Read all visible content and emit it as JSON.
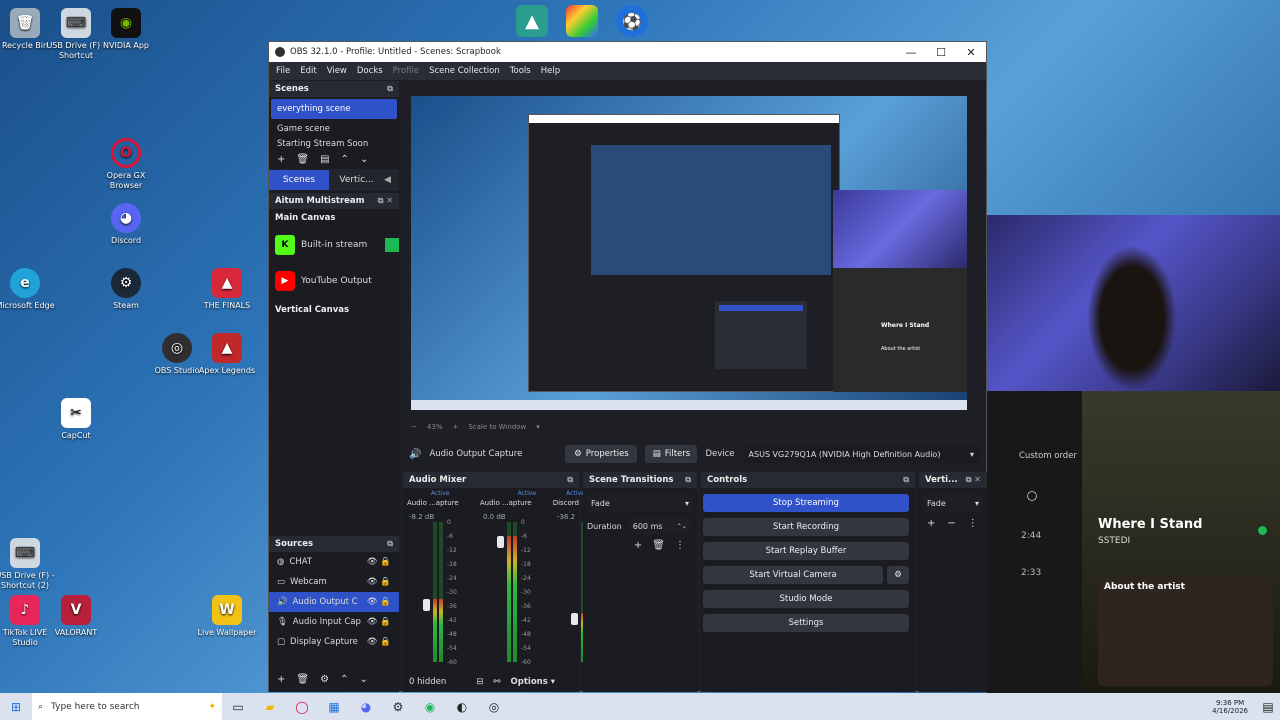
{
  "desktop_icons": [
    {
      "label": "Recycle Bin",
      "icon": "recycle-bin-icon",
      "glyph": "🗑",
      "color": "#9ab"
    },
    {
      "label": "USB Drive (F) - Shortcut",
      "icon": "usb-drive-icon",
      "glyph": "⌨",
      "color": "#cfd8e0"
    },
    {
      "label": "NVIDIA App",
      "icon": "nvidia-icon",
      "glyph": "◉",
      "color": "#76b900"
    },
    {
      "label": "Opera GX Browser",
      "icon": "opera-gx-icon",
      "glyph": "O",
      "color": "#d8143a"
    },
    {
      "label": "Discord",
      "icon": "discord-icon",
      "glyph": "◕",
      "color": "#5865f2"
    },
    {
      "label": "Microsoft Edge",
      "icon": "edge-icon",
      "glyph": "e",
      "color": "#1fa3d9"
    },
    {
      "label": "Steam",
      "icon": "steam-icon",
      "glyph": "⚙",
      "color": "#1b2838"
    },
    {
      "label": "THE FINALS",
      "icon": "the-finals-icon",
      "glyph": "▲",
      "color": "#d8283a"
    },
    {
      "label": "OBS Studio",
      "icon": "obs-icon",
      "glyph": "◎",
      "color": "#302e31"
    },
    {
      "label": "Apex Legends",
      "icon": "apex-icon",
      "glyph": "▲",
      "color": "#c0282a"
    },
    {
      "label": "CapCut",
      "icon": "capcut-icon",
      "glyph": "✂",
      "color": "#ffffff"
    },
    {
      "label": "USB Drive (F) - Shortcut (2)",
      "icon": "usb-drive-icon",
      "glyph": "⌨",
      "color": "#cfd8e0"
    },
    {
      "label": "TikTok LIVE Studio",
      "icon": "tiktok-icon",
      "glyph": "♪",
      "color": "#e8265a"
    },
    {
      "label": "VALORANT",
      "icon": "valorant-icon",
      "glyph": "V",
      "color": "#b8203a"
    },
    {
      "label": "Live Wallpaper",
      "icon": "live-wallpaper-icon",
      "glyph": "W",
      "color": "#f2c314"
    }
  ],
  "obs": {
    "title": "OBS 32.1.0 - Profile: Untitled - Scenes: Scrapbook",
    "menu": [
      "File",
      "Edit",
      "View",
      "Docks",
      "Profile",
      "Scene Collection",
      "Tools",
      "Help"
    ],
    "scenes_title": "Scenes",
    "scenes": [
      "everything scene",
      "Game scene",
      "Starting Stream Soon"
    ],
    "scene_tabs": [
      "Scenes",
      "Vertic..."
    ],
    "aitum_title": "Aitum Multistream",
    "main_canvas": "Main Canvas",
    "outputs": [
      {
        "label": "Built-in stream",
        "icon": "kick-icon",
        "color": "#53fc18"
      },
      {
        "label": "YouTube Output",
        "icon": "youtube-icon",
        "color": "#ff0000"
      }
    ],
    "vertical_canvas": "Vertical Canvas",
    "preview_zoom": "43%",
    "preview_scale": "Scale to Window",
    "source_name": "Audio Output Capture",
    "properties": "Properties",
    "filters": "Filters",
    "device_label": "Device",
    "device_value": "ASUS VG279Q1A (NVIDIA High Definition Audio)",
    "sources_title": "Sources",
    "sources": [
      {
        "label": "CHAT",
        "icon": "browser-icon"
      },
      {
        "label": "Webcam",
        "icon": "camera-icon"
      },
      {
        "label": "Audio Output C",
        "icon": "speaker-icon"
      },
      {
        "label": "Audio Input Cap",
        "icon": "mic-icon"
      },
      {
        "label": "Display Capture",
        "icon": "monitor-icon"
      }
    ],
    "hidden_count": "0 hidden",
    "options": "Options",
    "mixer_title": "Audio Mixer",
    "mixer_channels": [
      {
        "name": "Audio ...apture",
        "status": "Active",
        "db": "-8.2 dB",
        "level": 0.45
      },
      {
        "name": "Audio ...apture",
        "status": "Active",
        "db": "0.0 dB",
        "level": 0.9
      },
      {
        "name": "Discord",
        "status": "Active",
        "db": "-36.2",
        "level": 0.35
      }
    ],
    "mixer_scale": [
      "0",
      "-6",
      "-12",
      "-18",
      "-24",
      "-30",
      "-36",
      "-42",
      "-48",
      "-54",
      "-60"
    ],
    "transitions_title": "Scene Transitions",
    "transition": "Fade",
    "duration_label": "Duration",
    "duration_value": "600 ms",
    "controls_title": "Controls",
    "controls": [
      "Stop Streaming",
      "Start Recording",
      "Start Replay Buffer",
      "Start Virtual Camera",
      "Studio Mode",
      "Settings"
    ],
    "vertical_title": "Verti...",
    "vertical_transition": "Fade"
  },
  "spotify": {
    "custom_order": "Custom order",
    "durations": [
      "2:44",
      "2:33"
    ],
    "song": "Where I Stand",
    "artist": "SSTEDI",
    "about": "About the artist"
  },
  "taskbar": {
    "search_placeholder": "Type here to search",
    "time": "9:36 PM",
    "date": "4/16/2026"
  },
  "colors": {
    "accent": "#2f52c8",
    "window_bg": "#1e1f25",
    "panel_bg": "#1b1c22"
  }
}
